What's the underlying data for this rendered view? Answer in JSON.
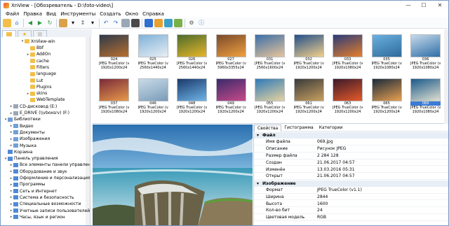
{
  "window": {
    "title": "XnView - [Обозреватель - D:\\foto-video\\]",
    "min": "—",
    "max": "☐",
    "close": "✕"
  },
  "menu": [
    "Файл",
    "Правка",
    "Вид",
    "Инструменты",
    "Создать",
    "Окно",
    "Справка"
  ],
  "tree": [
    {
      "label": "XnView-win",
      "level": 4,
      "arrow": "▾",
      "icon": "folder"
    },
    {
      "label": "Bbf",
      "level": 5,
      "arrow": "",
      "icon": "folder"
    },
    {
      "label": "AddOn",
      "level": 5,
      "arrow": "▸",
      "icon": "folder"
    },
    {
      "label": "cache",
      "level": 5,
      "arrow": "",
      "icon": "folder"
    },
    {
      "label": "Filters",
      "level": 5,
      "arrow": "",
      "icon": "folder"
    },
    {
      "label": "language",
      "level": 5,
      "arrow": "",
      "icon": "folder"
    },
    {
      "label": "Lut",
      "level": 5,
      "arrow": "",
      "icon": "folder"
    },
    {
      "label": "Plugins",
      "level": 5,
      "arrow": "",
      "icon": "folder"
    },
    {
      "label": "skins",
      "level": 5,
      "arrow": "▸",
      "icon": "folder"
    },
    {
      "label": "WebTemplate",
      "level": 5,
      "arrow": "",
      "icon": "folder"
    },
    {
      "label": "CD-дисковод (E:)",
      "level": 2,
      "arrow": "▸",
      "icon": "drive"
    },
    {
      "label": "E_DRIVE (\\\\vboxsrv) (F:)",
      "level": 2,
      "arrow": "▸",
      "icon": "drive"
    },
    {
      "label": "Библиотеки",
      "level": 1,
      "arrow": "▾",
      "icon": "lib"
    },
    {
      "label": "Видео",
      "level": 2,
      "arrow": "▸",
      "icon": "lib"
    },
    {
      "label": "Документы",
      "level": 2,
      "arrow": "▸",
      "icon": "lib"
    },
    {
      "label": "Изображения",
      "level": 2,
      "arrow": "▸",
      "icon": "lib"
    },
    {
      "label": "Музыка",
      "level": 2,
      "arrow": "▸",
      "icon": "lib"
    },
    {
      "label": "Корзина",
      "level": 1,
      "arrow": "",
      "icon": "sys"
    },
    {
      "label": "Панель управления",
      "level": 1,
      "arrow": "▾",
      "icon": "sys"
    },
    {
      "label": "Все элементы панели управления",
      "level": 2,
      "arrow": "▸",
      "icon": "sys"
    },
    {
      "label": "Оборудование и звук",
      "level": 2,
      "arrow": "▸",
      "icon": "sys"
    },
    {
      "label": "Оформление и персонализация",
      "level": 2,
      "arrow": "▸",
      "icon": "sys"
    },
    {
      "label": "Программы",
      "level": 2,
      "arrow": "▸",
      "icon": "sys"
    },
    {
      "label": "Сеть и Интернет",
      "level": 2,
      "arrow": "▸",
      "icon": "sys"
    },
    {
      "label": "Система и безопасность",
      "level": 2,
      "arrow": "▸",
      "icon": "sys"
    },
    {
      "label": "Специальные возможности",
      "level": 2,
      "arrow": "▸",
      "icon": "sys"
    },
    {
      "label": "Учетные записи пользователей",
      "level": 2,
      "arrow": "▸",
      "icon": "sys"
    },
    {
      "label": "Часы, язык и регион",
      "level": 2,
      "arrow": "▸",
      "icon": "sys"
    }
  ],
  "thumbnails": [
    {
      "name": "024",
      "info": "1920x1200x24",
      "colors": [
        "#2d3a4a",
        "#b86f2f"
      ]
    },
    {
      "name": "025",
      "info": "2560x1440x24",
      "colors": [
        "#7fb1d8",
        "#e8eef3"
      ]
    },
    {
      "name": "026",
      "info": "2560x1440x24",
      "colors": [
        "#4d6b2c",
        "#e7b62a"
      ]
    },
    {
      "name": "027",
      "info": "5960x3355x24",
      "colors": [
        "#7a4a2a",
        "#f0a040"
      ]
    },
    {
      "name": "031",
      "info": "2560x1600x24",
      "colors": [
        "#3a6ea8",
        "#e8c59a"
      ]
    },
    {
      "name": "032",
      "info": "1920x1200x24",
      "colors": [
        "#234f8a",
        "#f1d08a"
      ]
    },
    {
      "name": "033",
      "info": "1920x1080x24",
      "colors": [
        "#2a3a7a",
        "#e67f2a"
      ]
    },
    {
      "name": "035",
      "info": "1920x1080x24",
      "colors": [
        "#6ab0e0",
        "#2f6b9a"
      ]
    },
    {
      "name": "036",
      "info": "1920x1080x24",
      "colors": [
        "#c7d9ea",
        "#2f6fa8"
      ]
    },
    {
      "name": "037",
      "info": "1920x1080x24",
      "colors": [
        "#7a2a3a",
        "#e89a4a"
      ]
    },
    {
      "name": "046",
      "info": "1920x1200x24",
      "colors": [
        "#c9dbe8",
        "#7a9bb8"
      ]
    },
    {
      "name": "048",
      "info": "1920x1200x24",
      "colors": [
        "#1a3a6a",
        "#6fb4e8"
      ]
    },
    {
      "name": "049",
      "info": "1920x1200x24",
      "colors": [
        "#3a2a6a",
        "#c84a8a"
      ]
    },
    {
      "name": "055",
      "info": "1920x1200x24",
      "colors": [
        "#2f7ab8",
        "#e6d3a0"
      ]
    },
    {
      "name": "061",
      "info": "1920x1200x24",
      "colors": [
        "#3a3a3a",
        "#c8a060"
      ]
    },
    {
      "name": "063",
      "info": "1920x1200x24",
      "colors": [
        "#3a1a2a",
        "#e65a2a"
      ]
    },
    {
      "name": "065",
      "info": "1920x1200x24",
      "colors": [
        "#1a2a3a",
        "#e8a050"
      ]
    },
    {
      "name": "069",
      "info": "1920x1080x24",
      "colors": [
        "#1a5a8a",
        "#e0dfd0"
      ],
      "selected": true
    }
  ],
  "thumb_caption_template": "JPEG TrueColor (v1.1)",
  "props": {
    "tabs": [
      "Свойства",
      "Гистограмма",
      "Категории"
    ],
    "rows": [
      {
        "section": true,
        "k": "Файл"
      },
      {
        "k": "Имя файла",
        "v": "069.jpg"
      },
      {
        "k": "Описание",
        "v": "Рисунок JPEG"
      },
      {
        "k": "Размер файла",
        "v": "2 284 128"
      },
      {
        "k": "Создан",
        "v": "21.06.2017 04:57"
      },
      {
        "k": "Изменён",
        "v": "13.03.2016 05:31"
      },
      {
        "k": "Открыт",
        "v": "21.06.2017 04:57"
      },
      {
        "section": true,
        "k": "Изображение"
      },
      {
        "k": "Формат",
        "v": "JPEG TrueColor (v1.1)"
      },
      {
        "k": "Ширина",
        "v": "2844"
      },
      {
        "k": "Высота",
        "v": "1600"
      },
      {
        "k": "Кол-во бит",
        "v": "24"
      },
      {
        "k": "Цветовая модель",
        "v": "RGB"
      }
    ]
  }
}
